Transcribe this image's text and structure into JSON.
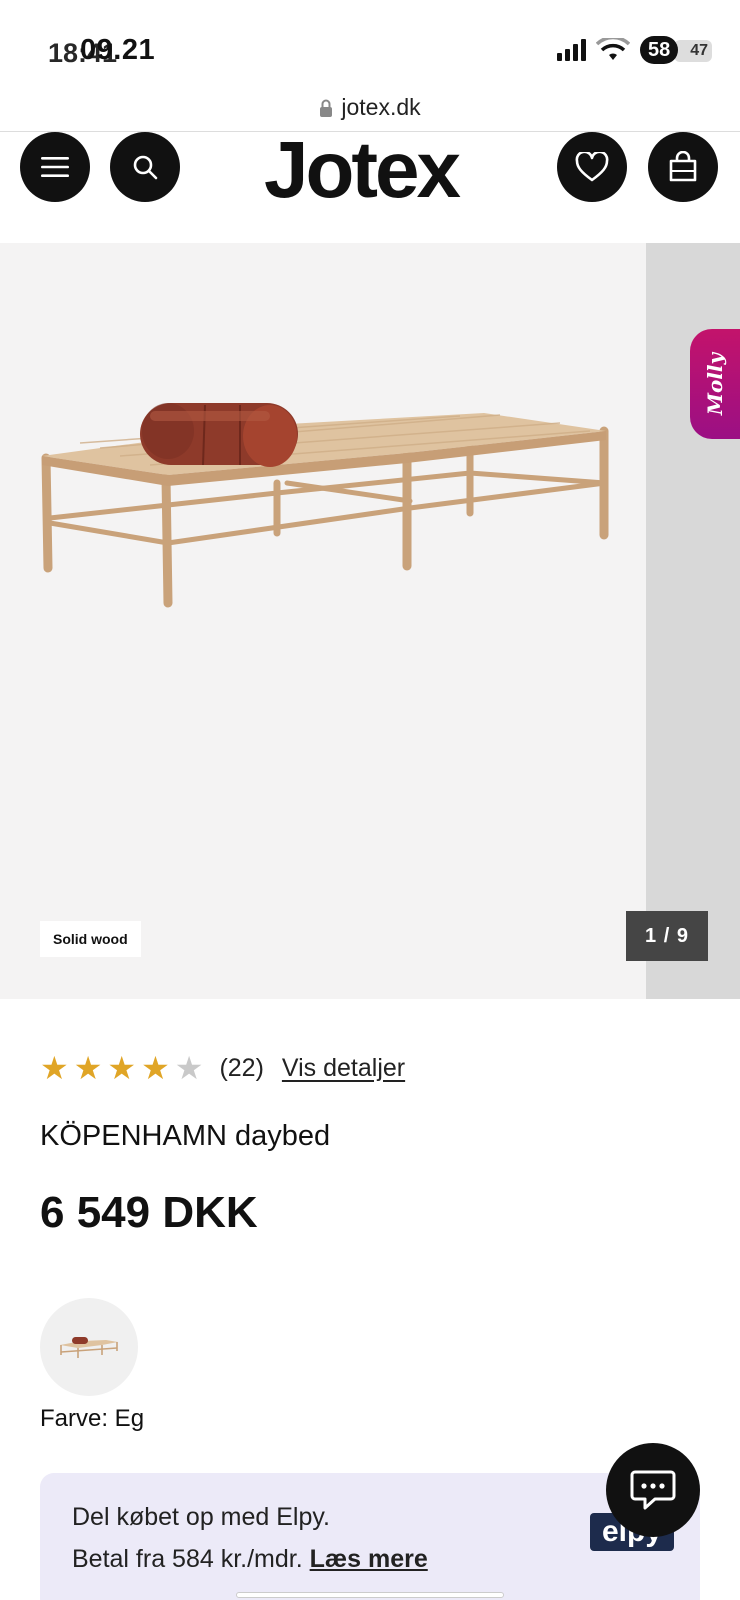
{
  "status_bar": {
    "time": "09.21",
    "time_ghost": "18:41",
    "battery": "58",
    "battery_ghost": "47"
  },
  "browser": {
    "url": "jotex.dk"
  },
  "header": {
    "logo": "Jotex",
    "icons": [
      "menu-icon",
      "search-icon",
      "heart-icon",
      "bag-icon"
    ]
  },
  "gallery": {
    "badge": "Solid wood",
    "counter": "1 / 9",
    "chat_tab": "Molly"
  },
  "product": {
    "rating": 4,
    "rating_max": 5,
    "review_count": "(22)",
    "details_link": "Vis detaljer",
    "name": "KÖPENHAMN daybed",
    "price": "6 549 DKK",
    "color_label": "Farve: Eg"
  },
  "elpy": {
    "line1": "Del købet op med Elpy.",
    "line2_prefix": "Betal fra 584 kr./mdr. ",
    "line2_link": "Læs mere",
    "logo": "elpy"
  },
  "colors": {
    "accent_star": "#e0a526",
    "elpy_bg": "#eceaf8",
    "molly": "#c3136b"
  }
}
